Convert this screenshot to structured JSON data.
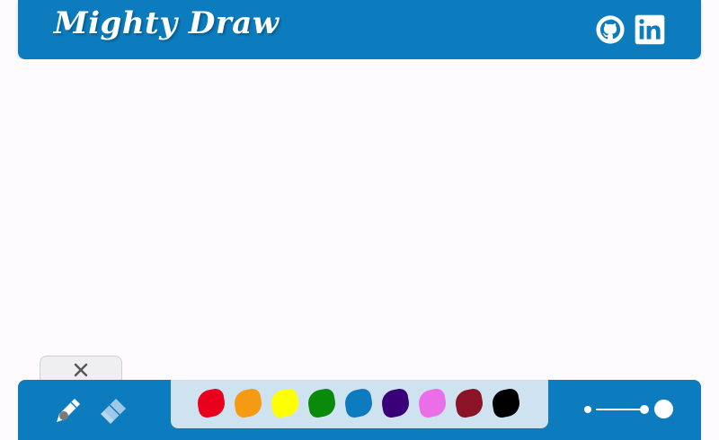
{
  "header": {
    "title": "Mighty Draw",
    "links": [
      {
        "name": "github",
        "icon": "github-icon"
      },
      {
        "name": "linkedin",
        "icon": "linkedin-icon"
      }
    ]
  },
  "close_tab": {
    "icon": "close-icon"
  },
  "tools": [
    {
      "name": "pencil",
      "icon": "pencil-icon",
      "selected": true
    },
    {
      "name": "eraser",
      "icon": "eraser-icon",
      "selected": false
    }
  ],
  "colors": {
    "brand": "#0c7cbf",
    "palette_bg": "#cfe2f0",
    "canvas_bg": "#fdfbfe"
  },
  "palette": [
    {
      "name": "red",
      "hex": "#e8001c"
    },
    {
      "name": "orange",
      "hex": "#f59a12"
    },
    {
      "name": "yellow",
      "hex": "#ffff00"
    },
    {
      "name": "green",
      "hex": "#0a8a0a"
    },
    {
      "name": "blue",
      "hex": "#0c7cbf"
    },
    {
      "name": "indigo",
      "hex": "#3a0078"
    },
    {
      "name": "pink",
      "hex": "#ea6ee8"
    },
    {
      "name": "maroon",
      "hex": "#8c1428"
    },
    {
      "name": "black",
      "hex": "#000000"
    }
  ],
  "brush_size": {
    "value": 0.85,
    "icons": [
      "small-dot-icon",
      "large-dot-icon"
    ]
  }
}
